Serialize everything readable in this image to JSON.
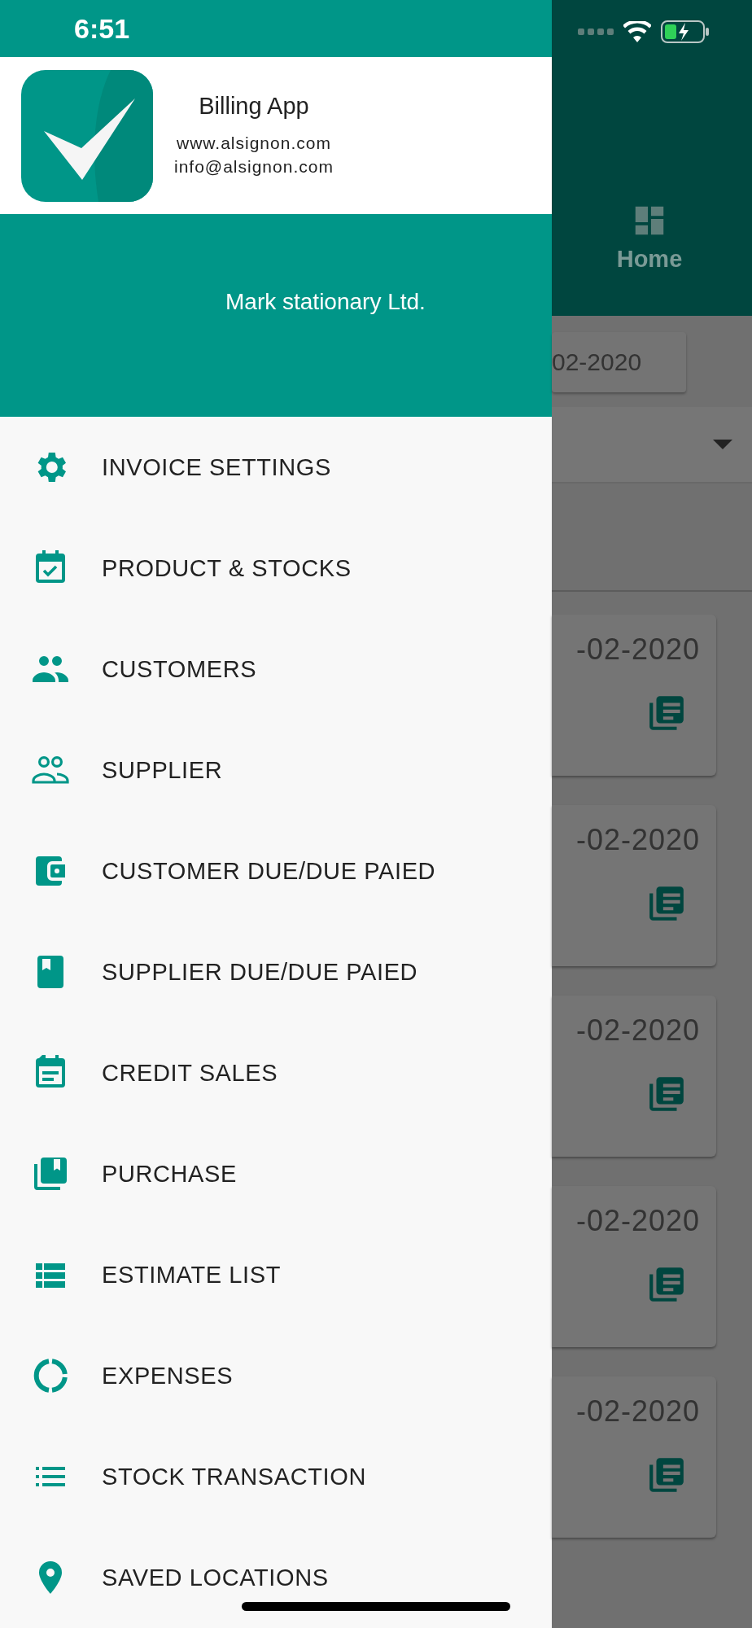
{
  "status_bar": {
    "time": "6:51"
  },
  "drawer": {
    "app_name": "Billing App",
    "website": "www.alsignon.com",
    "email": "info@alsignon.com",
    "company": "Mark stationary Ltd.",
    "items": [
      {
        "label": "INVOICE SETTINGS"
      },
      {
        "label": "PRODUCT & STOCKS"
      },
      {
        "label": "CUSTOMERS"
      },
      {
        "label": "SUPPLIER"
      },
      {
        "label": "CUSTOMER DUE/DUE PAIED"
      },
      {
        "label": "SUPPLIER DUE/DUE PAIED"
      },
      {
        "label": "CREDIT SALES"
      },
      {
        "label": "PURCHASE"
      },
      {
        "label": "ESTIMATE LIST"
      },
      {
        "label": "EXPENSES"
      },
      {
        "label": "STOCK TRANSACTION"
      },
      {
        "label": "SAVED LOCATIONS"
      }
    ]
  },
  "background": {
    "tab": {
      "label": "Home"
    },
    "date": "02-2020",
    "cards": [
      {
        "date": "-02-2020"
      },
      {
        "date": "-02-2020"
      },
      {
        "date": "-02-2020"
      },
      {
        "date": "-02-2020"
      },
      {
        "date": "-02-2020"
      }
    ]
  }
}
